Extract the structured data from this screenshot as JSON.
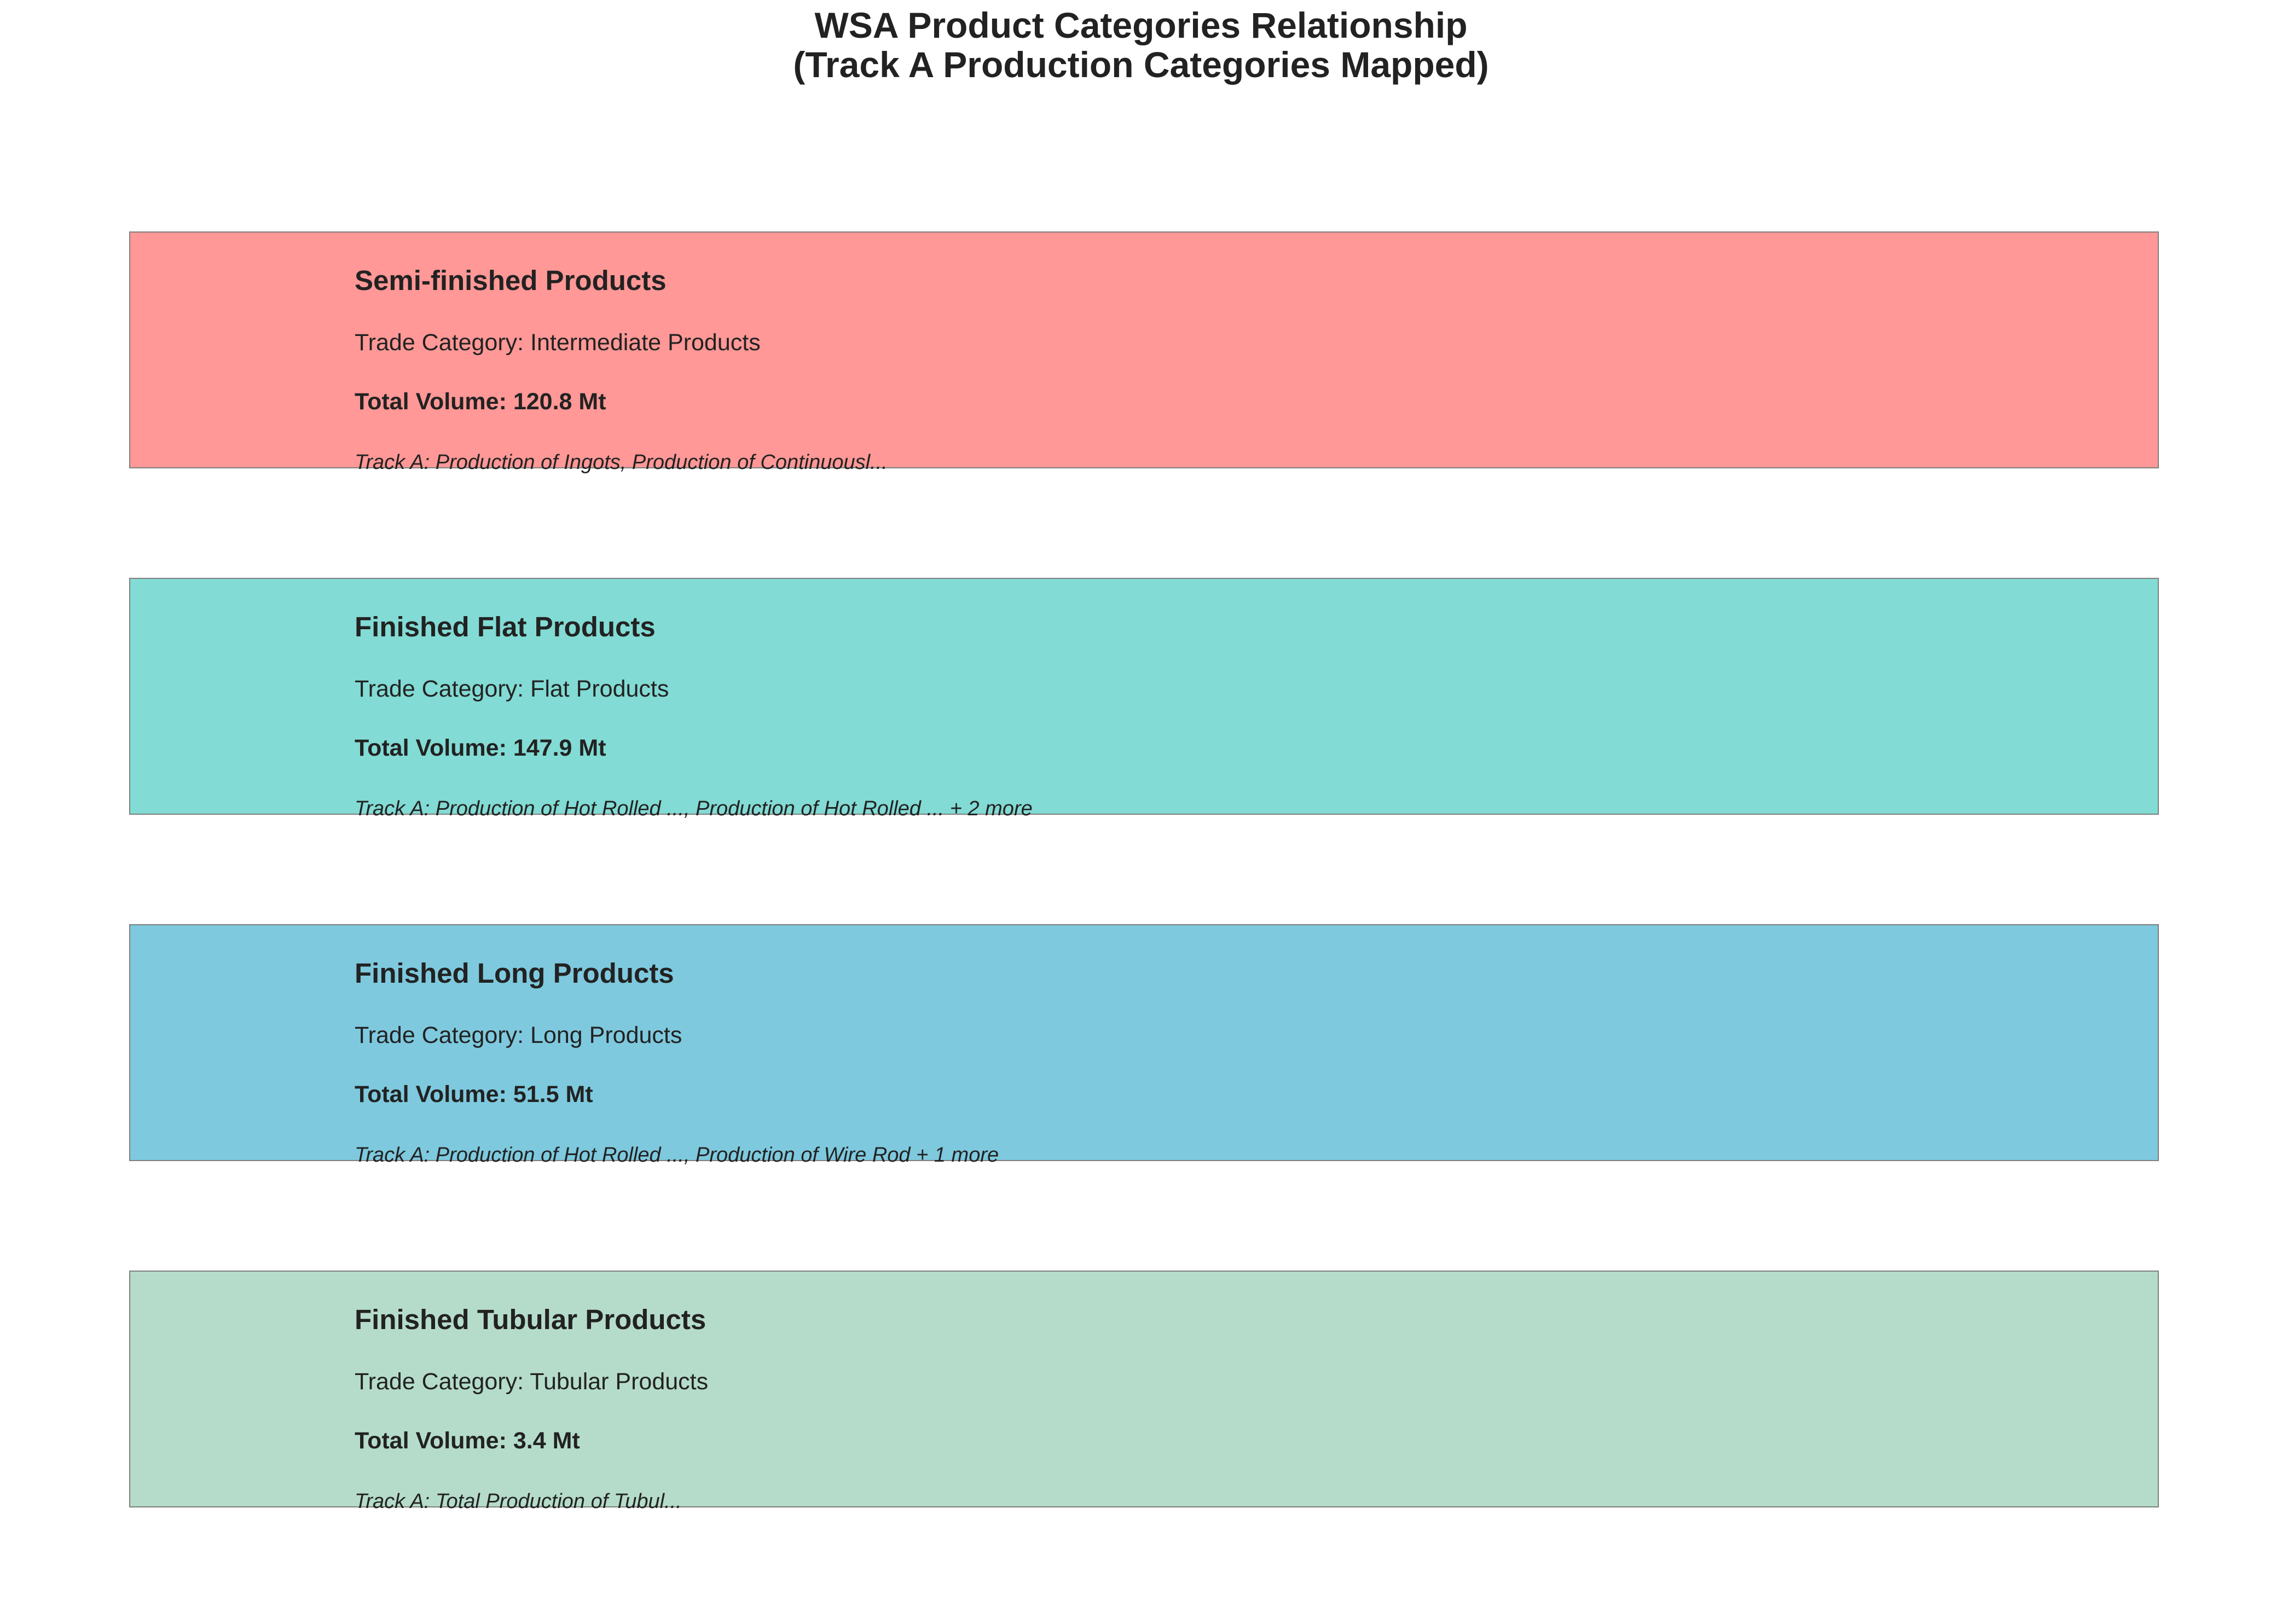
{
  "title": {
    "line1": "WSA Product Categories Relationship",
    "line2": "(Track A Production Categories Mapped)"
  },
  "categories": [
    {
      "name": "Semi-finished Products",
      "trade": "Trade Category: Intermediate Products",
      "volume": "Total Volume: 120.8 Mt",
      "track_a": "Track A: Production of Ingots, Production of Continuousl...",
      "color": "#ff9896"
    },
    {
      "name": "Finished Flat Products",
      "trade": "Trade Category: Flat Products",
      "volume": "Total Volume: 147.9 Mt",
      "track_a": "Track A: Production of Hot Rolled ..., Production of Hot Rolled ... + 2 more",
      "color": "#82dbd4"
    },
    {
      "name": "Finished Long Products",
      "trade": "Trade Category: Long Products",
      "volume": "Total Volume: 51.5 Mt",
      "track_a": "Track A: Production of Hot Rolled ..., Production of Wire Rod + 1 more",
      "color": "#7ec9de"
    },
    {
      "name": "Finished Tubular Products",
      "trade": "Trade Category: Tubular Products",
      "volume": "Total Volume: 3.4 Mt",
      "track_a": "Track A: Total Production of Tubul...",
      "color": "#b5dcca"
    }
  ]
}
